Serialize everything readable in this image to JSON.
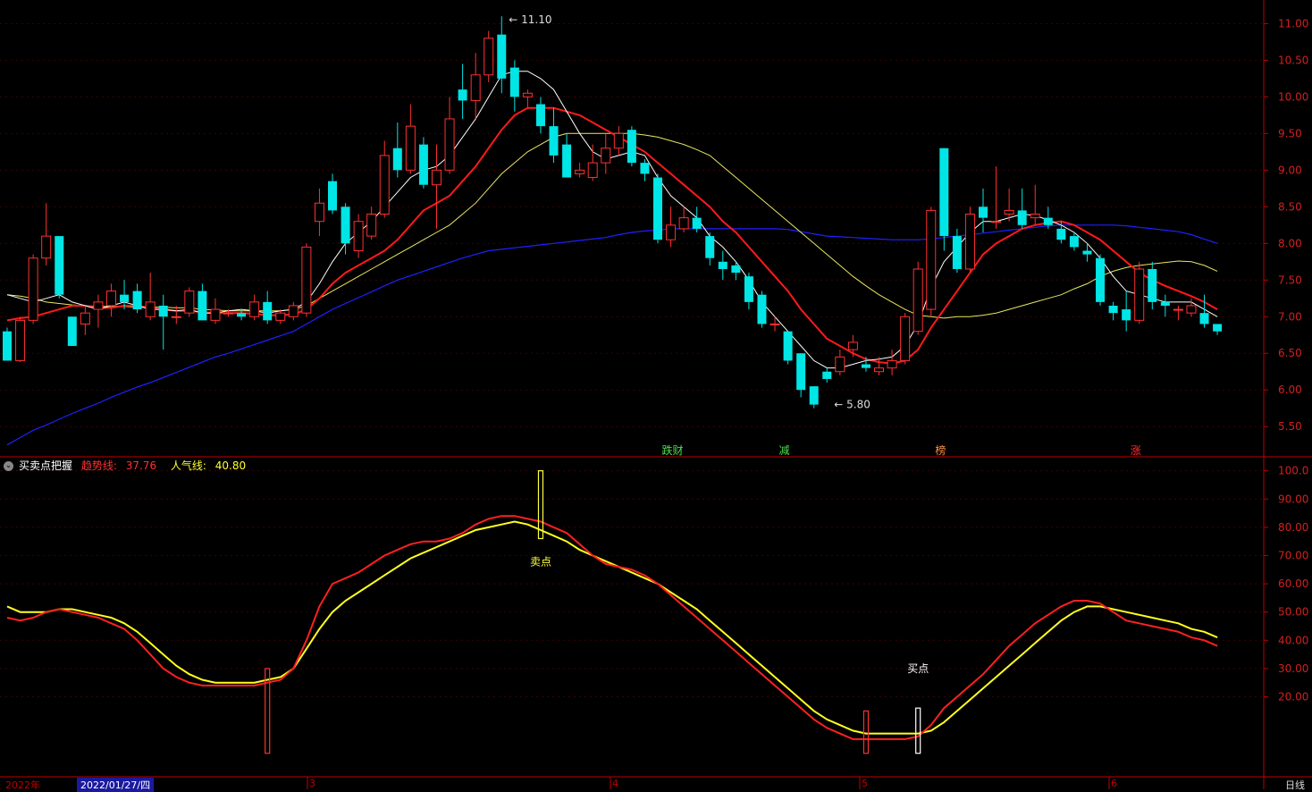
{
  "indicator": {
    "name": "买卖点把握",
    "trend_label": "趋势线:",
    "trend_value": "37.76",
    "popularity_label": "人气线:",
    "popularity_value": "40.80"
  },
  "bottom": {
    "year_label": "2022年",
    "cursor_date": "2022/01/27/四",
    "period": "日线",
    "months": [
      "3",
      "4",
      "5",
      "6"
    ]
  },
  "colors": {
    "background": "#000000",
    "up_candle": "#ff3030",
    "down_candle": "#00e5e5",
    "ma5": "#ffffff",
    "ma10": "#ff1a1a",
    "ma20": "#e8e860",
    "ma60": "#2020ff",
    "trend_line": "#ff2020",
    "popularity_line": "#ffff20",
    "axis": "#c00000"
  },
  "chart_data": [
    {
      "type": "candlestick",
      "yticks": [
        "11.00",
        "10.50",
        "10.00",
        "9.50",
        "9.00",
        "8.50",
        "8.00",
        "7.50",
        "7.00",
        "6.50",
        "6.00",
        "5.50"
      ],
      "ylim": [
        5.1,
        11.2
      ],
      "annotations": [
        {
          "label": "11.10",
          "index": 38,
          "value": 11.1
        },
        {
          "label": "5.80",
          "index": 63,
          "value": 5.8
        }
      ],
      "event_tags": [
        {
          "label": "跌财",
          "index": 51,
          "color": "#4de04d"
        },
        {
          "label": "减",
          "index": 60,
          "color": "#4de04d"
        },
        {
          "label": "榜",
          "index": 72,
          "color": "#ff9040"
        },
        {
          "label": "涨",
          "index": 87,
          "color": "#ff3030"
        }
      ],
      "candles": [
        [
          6.8,
          6.4,
          6.85,
          6.4
        ],
        [
          6.4,
          6.95,
          7.0,
          6.38
        ],
        [
          6.95,
          7.8,
          7.85,
          6.9
        ],
        [
          7.8,
          8.1,
          8.55,
          7.7
        ],
        [
          8.1,
          7.3,
          8.1,
          7.25
        ],
        [
          7.0,
          6.6,
          7.0,
          6.6
        ],
        [
          6.9,
          7.05,
          7.15,
          6.75
        ],
        [
          7.1,
          7.2,
          7.3,
          6.85
        ],
        [
          7.15,
          7.35,
          7.45,
          7.0
        ],
        [
          7.3,
          7.2,
          7.5,
          7.1
        ],
        [
          7.35,
          7.1,
          7.45,
          7.05
        ],
        [
          7.0,
          7.2,
          7.6,
          6.95
        ],
        [
          7.15,
          7.0,
          7.3,
          6.55
        ],
        [
          7.0,
          7.0,
          7.15,
          6.9
        ],
        [
          7.05,
          7.35,
          7.4,
          7.0
        ],
        [
          7.35,
          6.95,
          7.45,
          6.95
        ],
        [
          6.95,
          7.1,
          7.25,
          6.9
        ],
        [
          7.05,
          7.05,
          7.1,
          7.0
        ],
        [
          7.05,
          7.0,
          7.1,
          6.95
        ],
        [
          7.0,
          7.2,
          7.3,
          6.95
        ],
        [
          7.2,
          6.95,
          7.35,
          6.9
        ],
        [
          6.95,
          7.05,
          7.1,
          6.9
        ],
        [
          7.0,
          7.15,
          7.2,
          6.95
        ],
        [
          7.05,
          7.95,
          8.0,
          7.0
        ],
        [
          8.3,
          8.55,
          8.75,
          8.1
        ],
        [
          8.85,
          8.45,
          8.95,
          8.4
        ],
        [
          8.5,
          8.0,
          8.55,
          7.85
        ],
        [
          7.9,
          8.3,
          8.4,
          7.8
        ],
        [
          8.1,
          8.4,
          8.5,
          8.05
        ],
        [
          8.4,
          9.2,
          9.4,
          8.35
        ],
        [
          9.3,
          9.0,
          9.65,
          8.9
        ],
        [
          9.0,
          9.6,
          9.9,
          8.95
        ],
        [
          9.35,
          8.8,
          9.45,
          8.75
        ],
        [
          8.8,
          9.0,
          9.35,
          8.2
        ],
        [
          9.0,
          9.7,
          10.0,
          8.95
        ],
        [
          10.1,
          9.95,
          10.45,
          9.7
        ],
        [
          9.95,
          10.3,
          10.6,
          9.7
        ],
        [
          10.3,
          10.8,
          10.9,
          10.2
        ],
        [
          10.85,
          10.25,
          11.1,
          10.05
        ],
        [
          10.4,
          10.0,
          10.5,
          9.8
        ],
        [
          10.0,
          10.05,
          10.1,
          9.85
        ],
        [
          9.9,
          9.6,
          10.0,
          9.5
        ],
        [
          9.6,
          9.2,
          9.85,
          9.1
        ],
        [
          9.35,
          8.9,
          9.5,
          8.9
        ],
        [
          8.95,
          9.0,
          9.1,
          8.9
        ],
        [
          8.9,
          9.1,
          9.35,
          8.85
        ],
        [
          9.1,
          9.3,
          9.5,
          8.95
        ],
        [
          9.3,
          9.5,
          9.6,
          9.2
        ],
        [
          9.55,
          9.1,
          9.6,
          9.05
        ],
        [
          9.1,
          8.95,
          9.15,
          8.85
        ],
        [
          8.9,
          8.05,
          8.95,
          8.0
        ],
        [
          8.05,
          8.25,
          8.5,
          7.95
        ],
        [
          8.2,
          8.35,
          8.5,
          8.15
        ],
        [
          8.35,
          8.2,
          8.5,
          8.15
        ],
        [
          8.1,
          7.8,
          8.15,
          7.7
        ],
        [
          7.75,
          7.65,
          7.9,
          7.5
        ],
        [
          7.7,
          7.6,
          7.75,
          7.5
        ],
        [
          7.55,
          7.2,
          7.6,
          7.1
        ],
        [
          7.3,
          6.9,
          7.35,
          6.85
        ],
        [
          6.9,
          6.9,
          7.0,
          6.8
        ],
        [
          6.8,
          6.4,
          6.8,
          6.35
        ],
        [
          6.5,
          6.0,
          6.5,
          5.9
        ],
        [
          6.05,
          5.8,
          6.05,
          5.75
        ],
        [
          6.25,
          6.15,
          6.3,
          6.1
        ],
        [
          6.25,
          6.45,
          6.55,
          6.2
        ],
        [
          6.55,
          6.65,
          6.75,
          6.45
        ],
        [
          6.35,
          6.3,
          6.45,
          6.25
        ],
        [
          6.25,
          6.3,
          6.45,
          6.2
        ],
        [
          6.3,
          6.4,
          6.55,
          6.2
        ],
        [
          6.4,
          7.0,
          7.05,
          6.35
        ],
        [
          6.8,
          7.65,
          7.75,
          6.75
        ],
        [
          7.1,
          8.45,
          8.5,
          7.0
        ],
        [
          9.3,
          8.1,
          9.3,
          7.9
        ],
        [
          8.1,
          7.65,
          8.2,
          7.6
        ],
        [
          7.65,
          8.4,
          8.5,
          7.6
        ],
        [
          8.5,
          8.35,
          8.75,
          8.15
        ],
        [
          8.3,
          8.3,
          9.05,
          8.2
        ],
        [
          8.4,
          8.45,
          8.75,
          8.3
        ],
        [
          8.45,
          8.25,
          8.75,
          8.2
        ],
        [
          8.35,
          8.4,
          8.8,
          8.25
        ],
        [
          8.35,
          8.25,
          8.5,
          8.2
        ],
        [
          8.2,
          8.05,
          8.3,
          8.0
        ],
        [
          8.1,
          7.95,
          8.15,
          7.9
        ],
        [
          7.9,
          7.85,
          8.0,
          7.75
        ],
        [
          7.8,
          7.2,
          7.85,
          7.15
        ],
        [
          7.15,
          7.05,
          7.2,
          6.95
        ],
        [
          7.1,
          6.95,
          7.35,
          6.8
        ],
        [
          6.95,
          7.65,
          7.75,
          6.9
        ],
        [
          7.65,
          7.2,
          7.75,
          7.1
        ],
        [
          7.2,
          7.15,
          7.3,
          7.0
        ],
        [
          7.1,
          7.1,
          7.15,
          6.95
        ],
        [
          7.05,
          7.15,
          7.25,
          7.0
        ],
        [
          7.05,
          6.9,
          7.3,
          6.85
        ],
        [
          6.9,
          6.8,
          6.9,
          6.75
        ]
      ],
      "ma5": [
        7.3,
        7.25,
        7.2,
        7.25,
        7.3,
        7.2,
        7.15,
        7.1,
        7.15,
        7.2,
        7.15,
        7.1,
        7.1,
        7.08,
        7.1,
        7.05,
        7.05,
        7.08,
        7.1,
        7.08,
        7.05,
        7.08,
        7.1,
        7.2,
        7.45,
        7.75,
        8.0,
        8.15,
        8.3,
        8.5,
        8.7,
        8.9,
        9.0,
        9.05,
        9.2,
        9.45,
        9.7,
        10.0,
        10.3,
        10.35,
        10.35,
        10.25,
        10.1,
        9.8,
        9.5,
        9.25,
        9.15,
        9.2,
        9.25,
        9.2,
        8.9,
        8.65,
        8.5,
        8.35,
        8.1,
        7.95,
        7.75,
        7.5,
        7.2,
        7.0,
        6.8,
        6.6,
        6.4,
        6.3,
        6.3,
        6.35,
        6.4,
        6.42,
        6.45,
        6.6,
        6.9,
        7.4,
        7.75,
        7.95,
        8.15,
        8.3,
        8.3,
        8.35,
        8.4,
        8.38,
        8.32,
        8.25,
        8.15,
        8.0,
        7.8,
        7.55,
        7.35,
        7.3,
        7.25,
        7.2,
        7.2,
        7.2,
        7.1,
        7.0
      ],
      "ma10": [
        6.95,
        6.98,
        7.0,
        7.05,
        7.1,
        7.15,
        7.15,
        7.12,
        7.12,
        7.15,
        7.15,
        7.12,
        7.1,
        7.08,
        7.08,
        7.06,
        7.05,
        7.05,
        7.05,
        7.04,
        7.02,
        7.02,
        7.03,
        7.1,
        7.25,
        7.45,
        7.6,
        7.7,
        7.8,
        7.9,
        8.05,
        8.25,
        8.45,
        8.55,
        8.65,
        8.85,
        9.05,
        9.3,
        9.55,
        9.75,
        9.85,
        9.85,
        9.85,
        9.8,
        9.75,
        9.65,
        9.55,
        9.45,
        9.35,
        9.25,
        9.1,
        8.95,
        8.8,
        8.65,
        8.5,
        8.3,
        8.15,
        7.95,
        7.75,
        7.55,
        7.35,
        7.1,
        6.9,
        6.7,
        6.6,
        6.5,
        6.42,
        6.38,
        6.36,
        6.4,
        6.55,
        6.85,
        7.1,
        7.35,
        7.6,
        7.85,
        8.0,
        8.1,
        8.2,
        8.25,
        8.28,
        8.3,
        8.25,
        8.15,
        8.05,
        7.9,
        7.75,
        7.6,
        7.5,
        7.42,
        7.35,
        7.28,
        7.2,
        7.1
      ],
      "ma20": [
        7.3,
        7.28,
        7.25,
        7.2,
        7.18,
        7.16,
        7.15,
        7.14,
        7.14,
        7.14,
        7.13,
        7.13,
        7.13,
        7.12,
        7.12,
        7.1,
        7.09,
        7.08,
        7.08,
        7.08,
        7.08,
        7.08,
        7.1,
        7.15,
        7.25,
        7.35,
        7.45,
        7.55,
        7.65,
        7.75,
        7.85,
        7.95,
        8.05,
        8.15,
        8.25,
        8.4,
        8.55,
        8.75,
        8.95,
        9.1,
        9.25,
        9.35,
        9.45,
        9.5,
        9.5,
        9.5,
        9.5,
        9.5,
        9.5,
        9.48,
        9.45,
        9.4,
        9.35,
        9.28,
        9.2,
        9.05,
        8.9,
        8.75,
        8.6,
        8.45,
        8.3,
        8.15,
        8.0,
        7.85,
        7.7,
        7.55,
        7.42,
        7.3,
        7.2,
        7.1,
        7.02,
        7.0,
        6.98,
        7.0,
        7.0,
        7.02,
        7.05,
        7.1,
        7.15,
        7.2,
        7.25,
        7.3,
        7.38,
        7.45,
        7.55,
        7.62,
        7.67,
        7.7,
        7.72,
        7.74,
        7.76,
        7.75,
        7.7,
        7.62
      ],
      "ma60": [
        5.25,
        5.35,
        5.45,
        5.52,
        5.6,
        5.68,
        5.75,
        5.82,
        5.9,
        5.97,
        6.04,
        6.1,
        6.17,
        6.24,
        6.31,
        6.38,
        6.45,
        6.5,
        6.56,
        6.62,
        6.68,
        6.74,
        6.8,
        6.9,
        7.0,
        7.1,
        7.18,
        7.26,
        7.34,
        7.42,
        7.5,
        7.56,
        7.62,
        7.68,
        7.74,
        7.8,
        7.85,
        7.9,
        7.92,
        7.94,
        7.96,
        7.98,
        8.0,
        8.02,
        8.04,
        8.06,
        8.08,
        8.12,
        8.15,
        8.17,
        8.18,
        8.2,
        8.2,
        8.2,
        8.2,
        8.2,
        8.2,
        8.2,
        8.2,
        8.2,
        8.19,
        8.16,
        8.13,
        8.1,
        8.09,
        8.08,
        8.07,
        8.06,
        8.05,
        8.05,
        8.05,
        8.06,
        8.08,
        8.1,
        8.12,
        8.14,
        8.16,
        8.18,
        8.2,
        8.22,
        8.24,
        8.25,
        8.25,
        8.25,
        8.25,
        8.25,
        8.24,
        8.22,
        8.2,
        8.18,
        8.16,
        8.12,
        8.06,
        8.0
      ]
    },
    {
      "type": "line",
      "yticks": [
        "100.0",
        "90.00",
        "80.00",
        "70.00",
        "60.00",
        "50.00",
        "40.00",
        "30.00",
        "20.00"
      ],
      "ylim": [
        -8,
        104
      ],
      "series": [
        {
          "name": "趋势线",
          "values": [
            48,
            47,
            48,
            50,
            51,
            50,
            49,
            48,
            46,
            44,
            40,
            35,
            30,
            27,
            25,
            24,
            24,
            24,
            24,
            24,
            25,
            26,
            30,
            40,
            52,
            60,
            62,
            64,
            67,
            70,
            72,
            74,
            75,
            75,
            76,
            78,
            81,
            83,
            84,
            84,
            83,
            82,
            80,
            78,
            74,
            70,
            67,
            66,
            65,
            63,
            60,
            56,
            52,
            48,
            44,
            40,
            36,
            32,
            28,
            24,
            20,
            16,
            12,
            9,
            7,
            5,
            5,
            5,
            5,
            5,
            6,
            10,
            16,
            20,
            24,
            28,
            33,
            38,
            42,
            46,
            49,
            52,
            54,
            54,
            53,
            50,
            47,
            46,
            45,
            44,
            43,
            41,
            40,
            38
          ]
        },
        {
          "name": "人气线",
          "values": [
            52,
            50,
            50,
            50,
            51,
            51,
            50,
            49,
            48,
            46,
            43,
            39,
            35,
            31,
            28,
            26,
            25,
            25,
            25,
            25,
            26,
            27,
            30,
            37,
            44,
            50,
            54,
            57,
            60,
            63,
            66,
            69,
            71,
            73,
            75,
            77,
            79,
            80,
            81,
            82,
            81,
            79,
            77,
            75,
            72,
            70,
            68,
            66,
            64,
            62,
            60,
            57,
            54,
            51,
            47,
            43,
            39,
            35,
            31,
            27,
            23,
            19,
            15,
            12,
            10,
            8,
            7,
            7,
            7,
            7,
            7,
            8,
            11,
            15,
            19,
            23,
            27,
            31,
            35,
            39,
            43,
            47,
            50,
            52,
            52,
            51,
            50,
            49,
            48,
            47,
            46,
            44,
            43,
            41
          ]
        }
      ],
      "signals": [
        {
          "index": 20,
          "kind": "buy",
          "from": 0,
          "to": 30
        },
        {
          "index": 41,
          "kind": "sell",
          "label": "卖点",
          "from": 76,
          "to": 100
        },
        {
          "index": 66,
          "kind": "buy",
          "from": 0,
          "to": 15
        },
        {
          "index": 70,
          "kind": "buy",
          "label": "买点",
          "from": 0,
          "to": 16
        }
      ]
    }
  ]
}
